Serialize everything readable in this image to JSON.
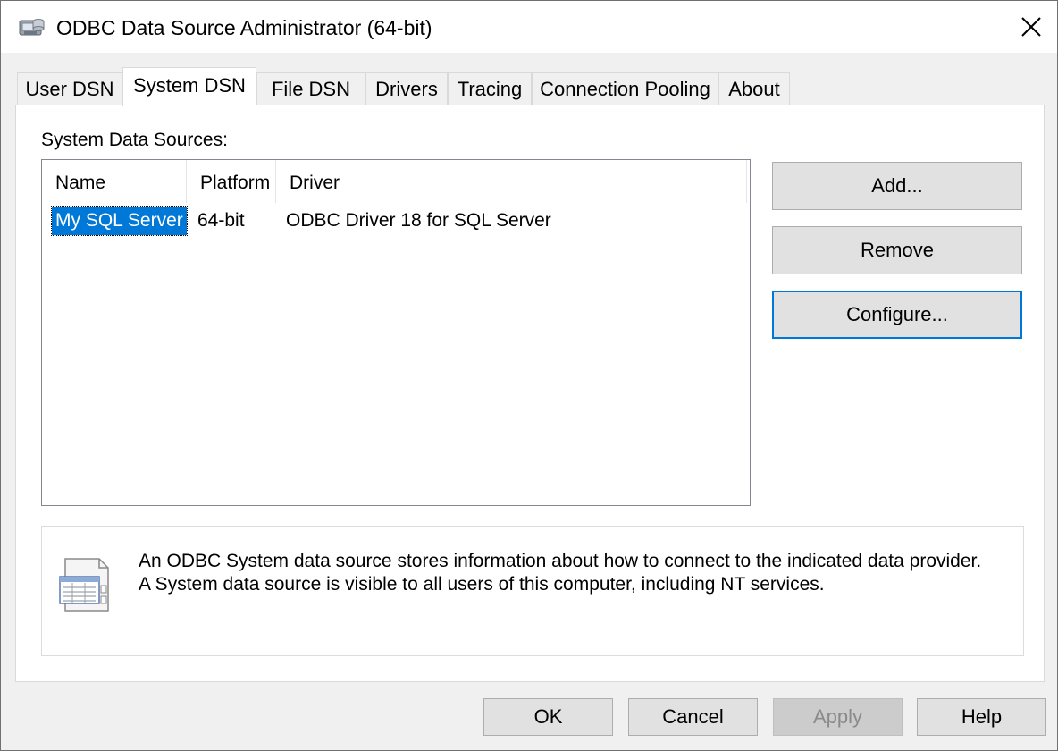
{
  "window": {
    "title": "ODBC Data Source Administrator (64-bit)"
  },
  "tabs": [
    {
      "label": "User DSN"
    },
    {
      "label": "System DSN",
      "active": true
    },
    {
      "label": "File DSN"
    },
    {
      "label": "Drivers"
    },
    {
      "label": "Tracing"
    },
    {
      "label": "Connection Pooling"
    },
    {
      "label": "About"
    }
  ],
  "section_label": "System Data Sources:",
  "table": {
    "columns": [
      "Name",
      "Platform",
      "Driver"
    ],
    "rows": [
      {
        "name": "My SQL Server",
        "platform": "64-bit",
        "driver": "ODBC Driver 18 for SQL Server",
        "selected": true
      }
    ]
  },
  "side_buttons": {
    "add": "Add...",
    "remove": "Remove",
    "configure": "Configure..."
  },
  "info": {
    "icon": "data-source-document-icon",
    "line1": "An ODBC System data source stores information about how to connect to the indicated data provider.",
    "line2": "A System data source is visible to all users of this computer, including NT services."
  },
  "footer_buttons": {
    "ok": "OK",
    "cancel": "Cancel",
    "apply": "Apply",
    "help": "Help"
  },
  "icons": {
    "app": "odbc-app-icon",
    "close": "close-icon"
  },
  "colors": {
    "selection": "#0078d7",
    "focus_border": "#0078d7"
  }
}
